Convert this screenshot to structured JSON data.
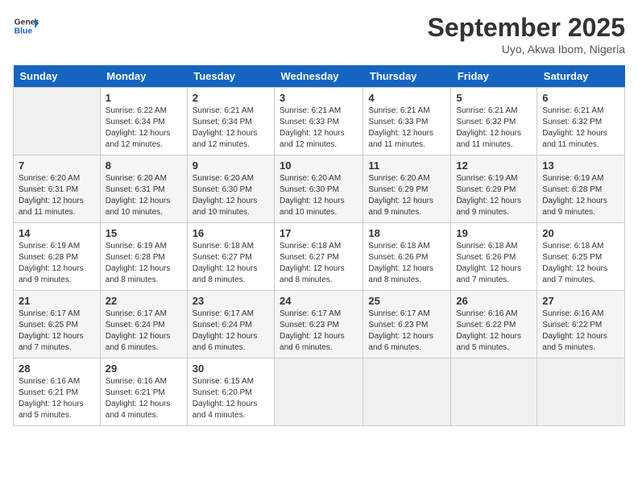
{
  "logo": {
    "line1": "General",
    "line2": "Blue"
  },
  "title": "September 2025",
  "subtitle": "Uyo, Akwa Ibom, Nigeria",
  "days_of_week": [
    "Sunday",
    "Monday",
    "Tuesday",
    "Wednesday",
    "Thursday",
    "Friday",
    "Saturday"
  ],
  "weeks": [
    [
      {
        "day": "",
        "info": ""
      },
      {
        "day": "1",
        "info": "Sunrise: 6:22 AM\nSunset: 6:34 PM\nDaylight: 12 hours\nand 12 minutes."
      },
      {
        "day": "2",
        "info": "Sunrise: 6:21 AM\nSunset: 6:34 PM\nDaylight: 12 hours\nand 12 minutes."
      },
      {
        "day": "3",
        "info": "Sunrise: 6:21 AM\nSunset: 6:33 PM\nDaylight: 12 hours\nand 12 minutes."
      },
      {
        "day": "4",
        "info": "Sunrise: 6:21 AM\nSunset: 6:33 PM\nDaylight: 12 hours\nand 11 minutes."
      },
      {
        "day": "5",
        "info": "Sunrise: 6:21 AM\nSunset: 6:32 PM\nDaylight: 12 hours\nand 11 minutes."
      },
      {
        "day": "6",
        "info": "Sunrise: 6:21 AM\nSunset: 6:32 PM\nDaylight: 12 hours\nand 11 minutes."
      }
    ],
    [
      {
        "day": "7",
        "info": "Sunrise: 6:20 AM\nSunset: 6:31 PM\nDaylight: 12 hours\nand 11 minutes."
      },
      {
        "day": "8",
        "info": "Sunrise: 6:20 AM\nSunset: 6:31 PM\nDaylight: 12 hours\nand 10 minutes."
      },
      {
        "day": "9",
        "info": "Sunrise: 6:20 AM\nSunset: 6:30 PM\nDaylight: 12 hours\nand 10 minutes."
      },
      {
        "day": "10",
        "info": "Sunrise: 6:20 AM\nSunset: 6:30 PM\nDaylight: 12 hours\nand 10 minutes."
      },
      {
        "day": "11",
        "info": "Sunrise: 6:20 AM\nSunset: 6:29 PM\nDaylight: 12 hours\nand 9 minutes."
      },
      {
        "day": "12",
        "info": "Sunrise: 6:19 AM\nSunset: 6:29 PM\nDaylight: 12 hours\nand 9 minutes."
      },
      {
        "day": "13",
        "info": "Sunrise: 6:19 AM\nSunset: 6:28 PM\nDaylight: 12 hours\nand 9 minutes."
      }
    ],
    [
      {
        "day": "14",
        "info": "Sunrise: 6:19 AM\nSunset: 6:28 PM\nDaylight: 12 hours\nand 9 minutes."
      },
      {
        "day": "15",
        "info": "Sunrise: 6:19 AM\nSunset: 6:28 PM\nDaylight: 12 hours\nand 8 minutes."
      },
      {
        "day": "16",
        "info": "Sunrise: 6:18 AM\nSunset: 6:27 PM\nDaylight: 12 hours\nand 8 minutes."
      },
      {
        "day": "17",
        "info": "Sunrise: 6:18 AM\nSunset: 6:27 PM\nDaylight: 12 hours\nand 8 minutes."
      },
      {
        "day": "18",
        "info": "Sunrise: 6:18 AM\nSunset: 6:26 PM\nDaylight: 12 hours\nand 8 minutes."
      },
      {
        "day": "19",
        "info": "Sunrise: 6:18 AM\nSunset: 6:26 PM\nDaylight: 12 hours\nand 7 minutes."
      },
      {
        "day": "20",
        "info": "Sunrise: 6:18 AM\nSunset: 6:25 PM\nDaylight: 12 hours\nand 7 minutes."
      }
    ],
    [
      {
        "day": "21",
        "info": "Sunrise: 6:17 AM\nSunset: 6:25 PM\nDaylight: 12 hours\nand 7 minutes."
      },
      {
        "day": "22",
        "info": "Sunrise: 6:17 AM\nSunset: 6:24 PM\nDaylight: 12 hours\nand 6 minutes."
      },
      {
        "day": "23",
        "info": "Sunrise: 6:17 AM\nSunset: 6:24 PM\nDaylight: 12 hours\nand 6 minutes."
      },
      {
        "day": "24",
        "info": "Sunrise: 6:17 AM\nSunset: 6:23 PM\nDaylight: 12 hours\nand 6 minutes."
      },
      {
        "day": "25",
        "info": "Sunrise: 6:17 AM\nSunset: 6:23 PM\nDaylight: 12 hours\nand 6 minutes."
      },
      {
        "day": "26",
        "info": "Sunrise: 6:16 AM\nSunset: 6:22 PM\nDaylight: 12 hours\nand 5 minutes."
      },
      {
        "day": "27",
        "info": "Sunrise: 6:16 AM\nSunset: 6:22 PM\nDaylight: 12 hours\nand 5 minutes."
      }
    ],
    [
      {
        "day": "28",
        "info": "Sunrise: 6:16 AM\nSunset: 6:21 PM\nDaylight: 12 hours\nand 5 minutes."
      },
      {
        "day": "29",
        "info": "Sunrise: 6:16 AM\nSunset: 6:21 PM\nDaylight: 12 hours\nand 4 minutes."
      },
      {
        "day": "30",
        "info": "Sunrise: 6:15 AM\nSunset: 6:20 PM\nDaylight: 12 hours\nand 4 minutes."
      },
      {
        "day": "",
        "info": ""
      },
      {
        "day": "",
        "info": ""
      },
      {
        "day": "",
        "info": ""
      },
      {
        "day": "",
        "info": ""
      }
    ]
  ]
}
